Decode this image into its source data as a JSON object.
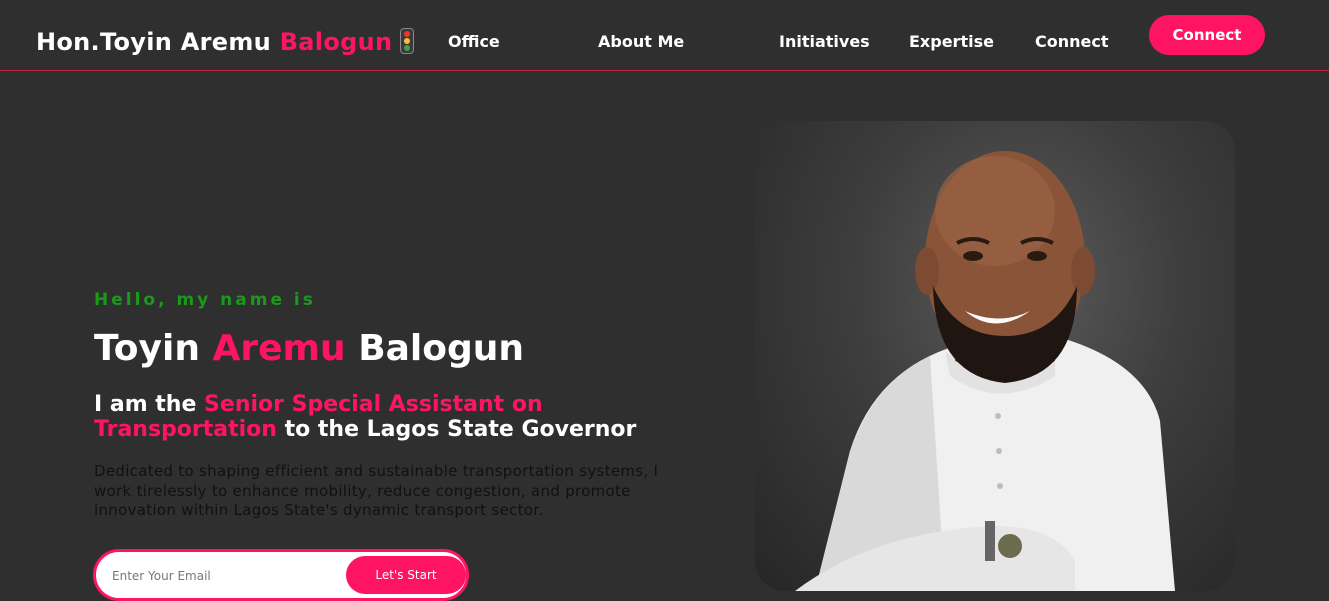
{
  "brand": {
    "name_part1": "Hon.Toyin Aremu ",
    "name_accent": "Balogun",
    "icon": "traffic-light-icon"
  },
  "nav": {
    "links": [
      "Office",
      "About Me",
      "Initiatives",
      "Expertise",
      "Connect"
    ],
    "cta": "Connect"
  },
  "hero": {
    "greeting": "Hello, my name is",
    "name_first": "Toyin ",
    "name_accent": "Aremu",
    "name_last": " Balogun",
    "role_prefix": "I am the ",
    "role_accent": "Senior Special Assistant on Transportation",
    "role_suffix": " to the Lagos State Governor",
    "description": "Dedicated to shaping efficient and sustainable transportation systems, I work tirelessly to enhance mobility, reduce congestion, and promote innovation within Lagos State's dynamic transport sector.",
    "email_placeholder": "Enter Your Email",
    "submit_label": "Let's Start"
  },
  "colors": {
    "accent": "#ff1464",
    "background": "#2f2f2f",
    "greeting": "#1a9a1a"
  }
}
